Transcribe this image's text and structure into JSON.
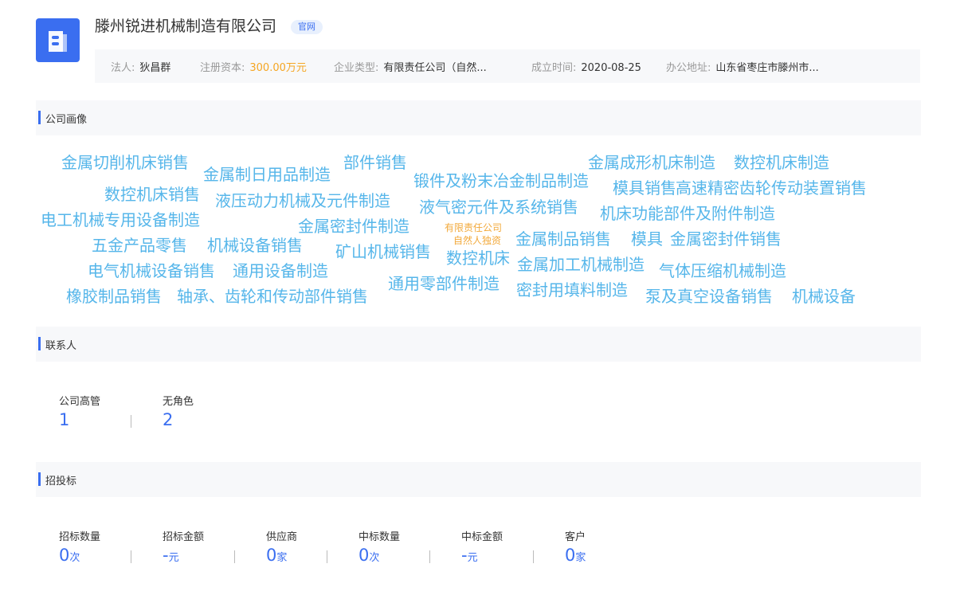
{
  "company": {
    "name": "滕州锐进机械制造有限公司",
    "badge": "官网",
    "logo_icon": "building-icon",
    "info": [
      {
        "label": "法人:",
        "value": "狄昌群"
      },
      {
        "label": "注册资本:",
        "value": "300.00万元"
      },
      {
        "label": "企业类型:",
        "value": "有限责任公司（自然..."
      },
      {
        "label": "成立时间:",
        "value": "2020-08-25"
      },
      {
        "label": "办公地址:",
        "value": "山东省枣庄市滕州市..."
      }
    ]
  },
  "sections": {
    "portrait": "公司画像",
    "contacts": "联系人",
    "bidding": "招投标"
  },
  "word_cloud": [
    "金属切削机床销售",
    "金属制日用品制造",
    "部件销售",
    "金属成形机床制造",
    "数控机床制造",
    "锻件及粉末冶金制品制造",
    "数控机床销售",
    "液压动力机械及元件制造",
    "模具销售",
    "高速精密齿轮传动装置销售",
    "液气密元件及系统销售",
    "电工机械专用设备制造",
    "机床功能部件及附件制造",
    "金属密封件制造",
    "有限责任公司",
    "自然人独资",
    "五金产品零售",
    "机械设备销售",
    "金属制品销售",
    "模具",
    "金属密封件销售",
    "矿山机械销售",
    "数控机床",
    "电气机械设备销售",
    "金属加工机械制造",
    "通用设备制造",
    "气体压缩机械制造",
    "通用零部件制造",
    "橡胶制品销售",
    "轴承、齿轮和传动部件销售",
    "密封用填料制造",
    "泵及真空设备销售",
    "机械设备"
  ],
  "contacts": [
    {
      "label": "公司高管",
      "value": "1"
    },
    {
      "label": "无角色",
      "value": "2"
    }
  ],
  "bidding": [
    {
      "label": "招标数量",
      "value": "0",
      "unit": "次"
    },
    {
      "label": "招标金额",
      "value": "-",
      "unit": "元"
    },
    {
      "label": "供应商",
      "value": "0",
      "unit": "家"
    },
    {
      "label": "中标数量",
      "value": "0",
      "unit": "次"
    },
    {
      "label": "中标金额",
      "value": "-",
      "unit": "元"
    },
    {
      "label": "客户",
      "value": "0",
      "unit": "家"
    }
  ],
  "colors": {
    "accent": "#3a6ef0",
    "cloud_word": "#56b6ea",
    "cloud_highlight": "#f2a93b",
    "money": "#f5a623"
  }
}
